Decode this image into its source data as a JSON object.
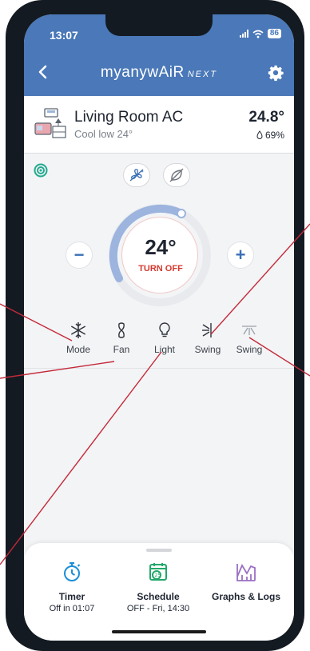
{
  "status_bar": {
    "time": "13:07",
    "battery": "86"
  },
  "header": {
    "brand": "myanywAiR",
    "brand_suffix": "NEXT",
    "accent_color": "#4a78b8"
  },
  "device": {
    "name": "Living Room AC",
    "mode_summary": "Cool low 24°",
    "room_temperature": "24.8°",
    "humidity": "69%"
  },
  "thermostat": {
    "setpoint": "24°",
    "power_label": "TURN OFF",
    "decrease": "−",
    "increase": "+"
  },
  "controls": [
    {
      "label": "Mode",
      "icon": "snowflake-icon"
    },
    {
      "label": "Fan",
      "icon": "fan-icon"
    },
    {
      "label": "Light",
      "icon": "lightbulb-icon"
    },
    {
      "label": "Swing",
      "icon": "vertical-swing-icon"
    },
    {
      "label": "Swing",
      "icon": "horizontal-swing-icon"
    }
  ],
  "bottom_tabs": [
    {
      "label": "Timer",
      "sub": "Off in 01:07",
      "icon": "stopwatch-icon",
      "color": "#1a8fd6"
    },
    {
      "label": "Schedule",
      "sub": "OFF - Fri, 14:30",
      "icon": "calendar-icon",
      "color": "#22a86a"
    },
    {
      "label": "Graphs & Logs",
      "sub": "",
      "icon": "chart-icon",
      "color": "#9a6fc4"
    }
  ]
}
